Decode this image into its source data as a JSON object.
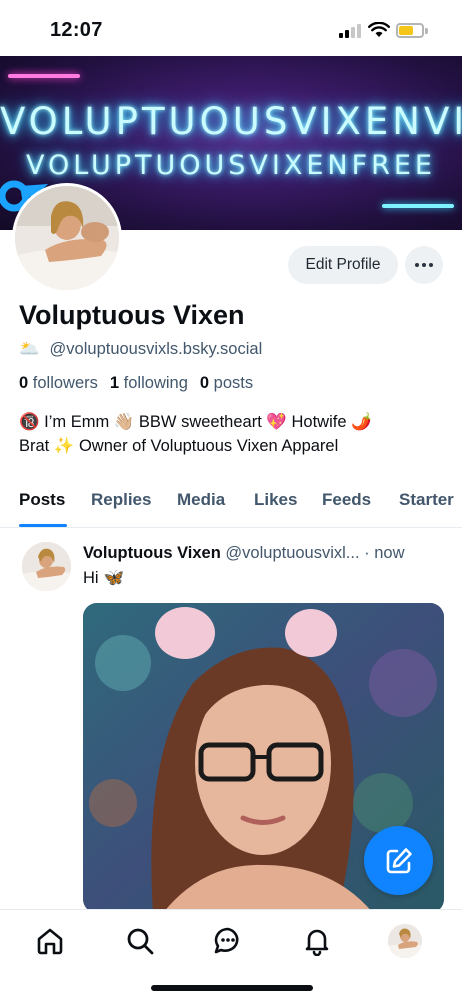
{
  "status_bar": {
    "time": "12:07",
    "battery_level": 0.65
  },
  "banner": {
    "line1": "VOLUPTUOUSVIXENVIP",
    "line2": "VOLUPTUOUSVIXENFREE"
  },
  "profile": {
    "edit_label": "Edit Profile",
    "display_name": "Voluptuous Vixen",
    "handle_emoji": "🌥️",
    "handle": "@voluptuousvixls.bsky.social",
    "followers_count": "0",
    "followers_label": "followers",
    "following_count": "1",
    "following_label": "following",
    "posts_count": "0",
    "posts_label": "posts",
    "bio_line1": "🔞 I’m Emm 👋🏼 BBW sweetheart 💖 Hotwife 🌶️",
    "bio_line2": "Brat ✨ Owner of Voluptuous Vixen Apparel"
  },
  "tabs": [
    "Posts",
    "Replies",
    "Media",
    "Likes",
    "Feeds",
    "Starter"
  ],
  "post": {
    "author": "Voluptuous Vixen",
    "handle": "@voluptuousvixl...",
    "time": "· now",
    "text": "Hi",
    "text_emoji": "🦋"
  },
  "colors": {
    "accent": "#1083fe",
    "muted_text": "#42576c",
    "button_bg": "#eef1f4",
    "neon_cyan": "#c9fbff",
    "banner_purple": "#3a1a66"
  },
  "icons": [
    "signal-icon",
    "wifi-icon",
    "battery-icon",
    "more-icon",
    "compose-icon",
    "home-icon",
    "search-icon",
    "chat-icon",
    "bell-icon"
  ]
}
